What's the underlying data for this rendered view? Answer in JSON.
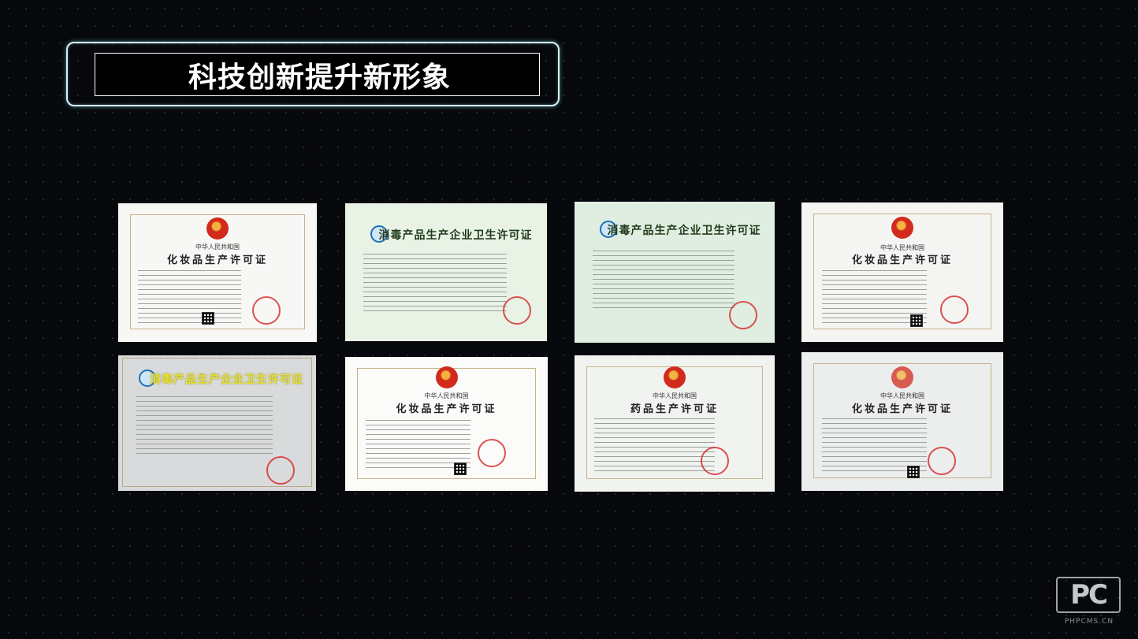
{
  "slide": {
    "title": "科技创新提升新形象"
  },
  "certificates": [
    {
      "header_small": "中华人民共和国",
      "header_main": "化妆品生产许可证"
    },
    {
      "header_main": "消毒产品生产企业卫生许可证"
    },
    {
      "header_main": "消毒产品生产企业卫生许可证"
    },
    {
      "header_small": "中华人民共和国",
      "header_main": "化妆品生产许可证"
    },
    {
      "header_main": "消毒产品生产企业卫生许可证"
    },
    {
      "header_small": "中华人民共和国",
      "header_main": "化妆品生产许可证"
    },
    {
      "header_small": "中华人民共和国",
      "header_main": "药品生产许可证"
    },
    {
      "header_small": "中华人民共和国",
      "header_main": "化妆品生产许可证"
    }
  ],
  "watermark": {
    "logo_text": "PC",
    "url": "PHPCMS.CN"
  }
}
